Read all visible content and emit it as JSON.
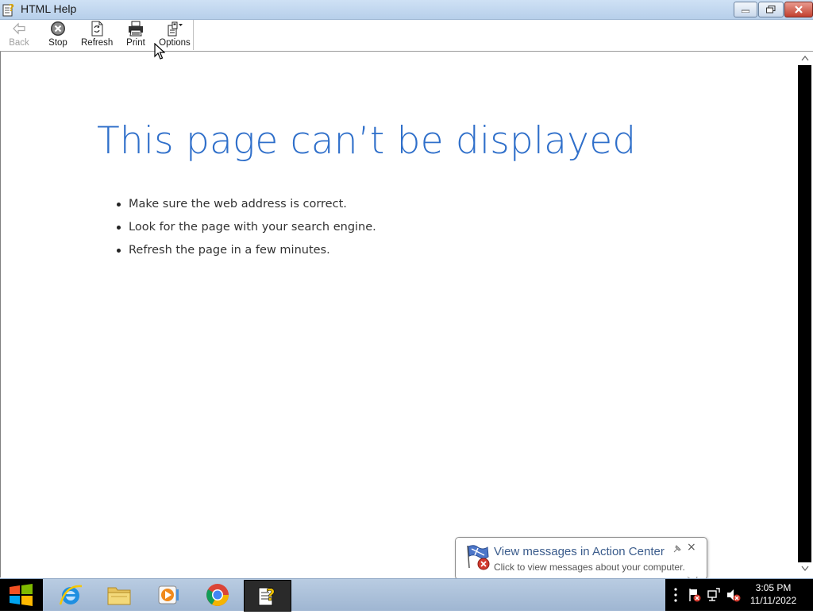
{
  "window": {
    "title": "HTML Help"
  },
  "toolbar": {
    "back_label": "Back",
    "stop_label": "Stop",
    "refresh_label": "Refresh",
    "print_label": "Print",
    "options_label": "Options"
  },
  "page": {
    "heading": "This page can’t be displayed",
    "tips": [
      "Make sure the web address  is correct.",
      "Look for the page with your search engine.",
      "Refresh the page in a few minutes."
    ]
  },
  "notification": {
    "title": "View messages in Action Center",
    "body": "Click to view messages about your computer.",
    "close_symbol": "×"
  },
  "taskbar": {
    "apps": [
      "internet-explorer-icon",
      "file-explorer-icon",
      "media-player-icon",
      "chrome-icon",
      "html-help-icon"
    ],
    "time": "3:05 PM",
    "date": "11/11/2022"
  },
  "colors": {
    "heading": "#2f6fca",
    "taskbar": "#b9cce2",
    "titlebar": "#cfe1f5"
  }
}
